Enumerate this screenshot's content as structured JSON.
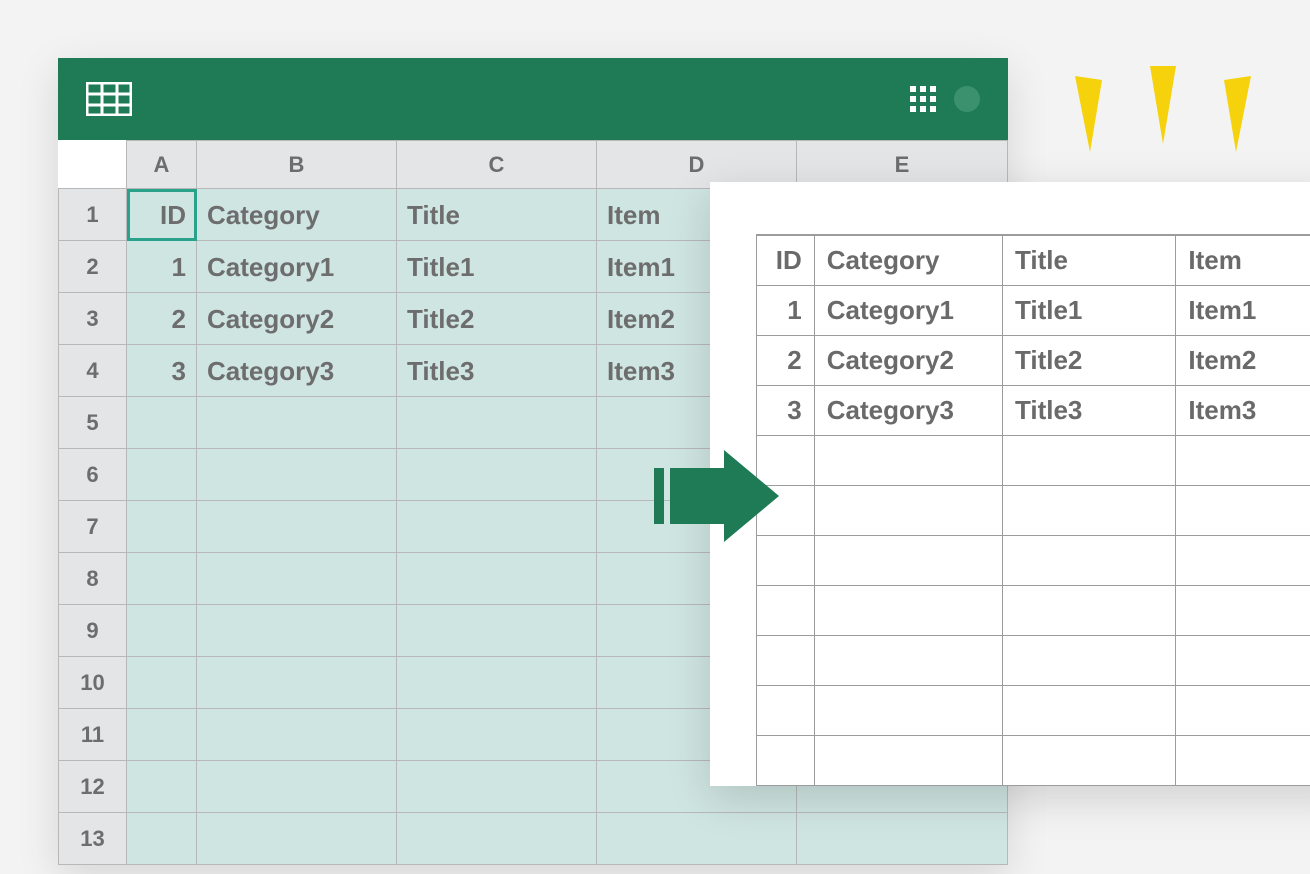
{
  "spreadsheet": {
    "columns": [
      "A",
      "B",
      "C",
      "D",
      "E"
    ],
    "row_numbers": [
      "1",
      "2",
      "3",
      "4",
      "5",
      "6",
      "7",
      "8",
      "9",
      "10",
      "11",
      "12",
      "13"
    ],
    "active_cell": "A1",
    "rows": [
      {
        "A": "ID",
        "B": "Category",
        "C": "Title",
        "D": "Item",
        "E": ""
      },
      {
        "A": "1",
        "B": "Category1",
        "C": "Title1",
        "D": "Item1",
        "E": ""
      },
      {
        "A": "2",
        "B": "Category2",
        "C": "Title2",
        "D": "Item2",
        "E": ""
      },
      {
        "A": "3",
        "B": "Category3",
        "C": "Title3",
        "D": "Item3",
        "E": ""
      }
    ]
  },
  "output_table": {
    "headers": [
      "ID",
      "Category",
      "Title",
      "Item"
    ],
    "rows": [
      {
        "id": "1",
        "category": "Category1",
        "title": "Title1",
        "item": "Item1"
      },
      {
        "id": "2",
        "category": "Category2",
        "title": "Title2",
        "item": "Item2"
      },
      {
        "id": "3",
        "category": "Category3",
        "title": "Title3",
        "item": "Item3"
      }
    ],
    "empty_rows": 7
  },
  "colors": {
    "brand": "#1e7b55",
    "selection": "#cfe5e1",
    "accent": "#f5d20b"
  }
}
